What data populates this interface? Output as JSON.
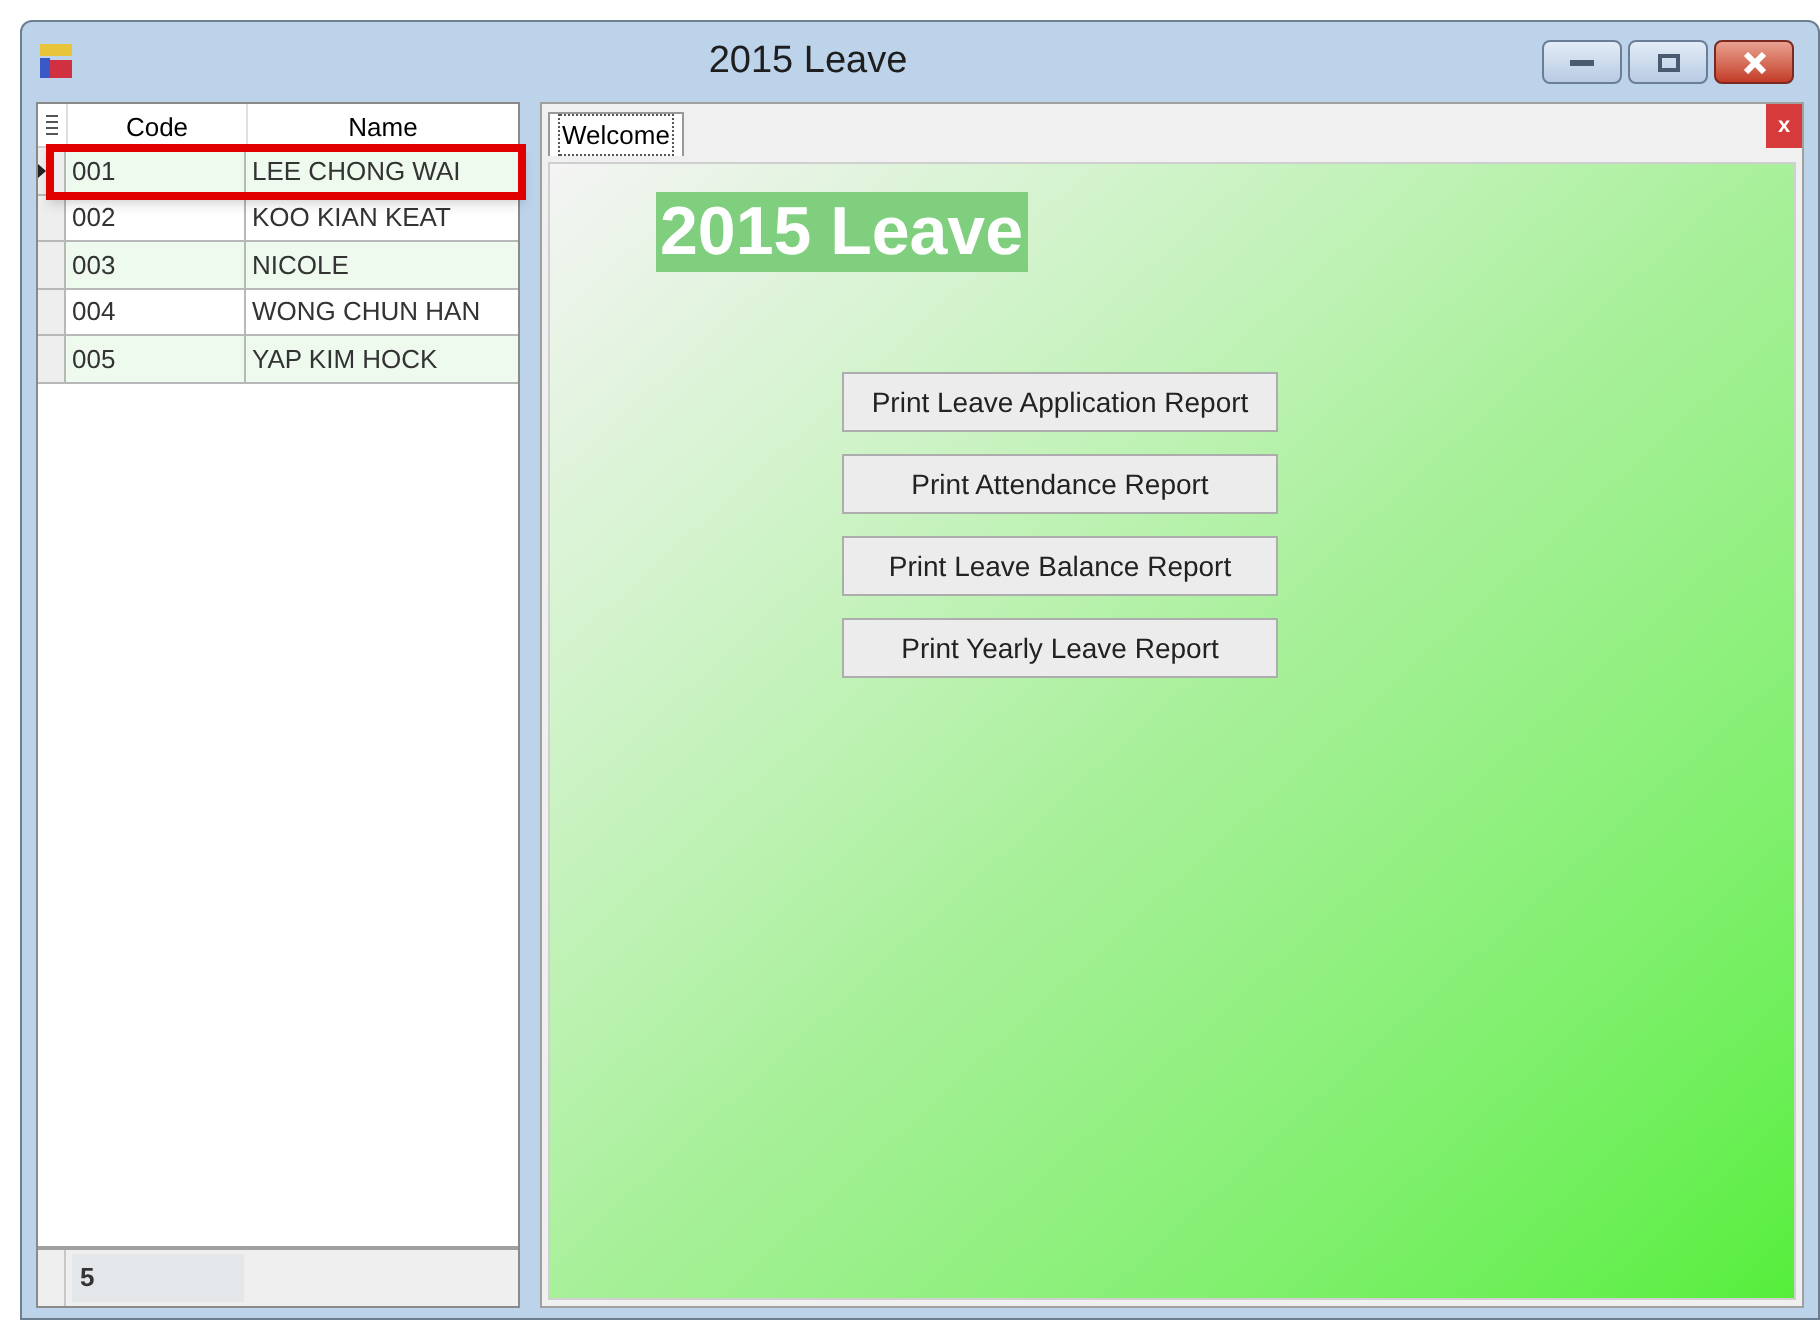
{
  "window": {
    "title": "2015 Leave"
  },
  "grid": {
    "columns": [
      "Code",
      "Name"
    ],
    "rows": [
      {
        "code": "001",
        "name": "LEE CHONG WAI",
        "selected": true
      },
      {
        "code": "002",
        "name": "KOO KIAN KEAT",
        "selected": false
      },
      {
        "code": "003",
        "name": "NICOLE",
        "selected": false
      },
      {
        "code": "004",
        "name": "WONG CHUN HAN",
        "selected": false
      },
      {
        "code": "005",
        "name": "YAP KIM HOCK",
        "selected": false
      }
    ],
    "footer_count": "5"
  },
  "tabs": [
    {
      "label": "Welcome",
      "selected": true
    }
  ],
  "tab_close": "x",
  "welcome": {
    "heading": "2015 Leave",
    "buttons": [
      "Print Leave Application Report",
      "Print Attendance Report",
      "Print Leave Balance Report",
      "Print Yearly Leave Report"
    ]
  }
}
